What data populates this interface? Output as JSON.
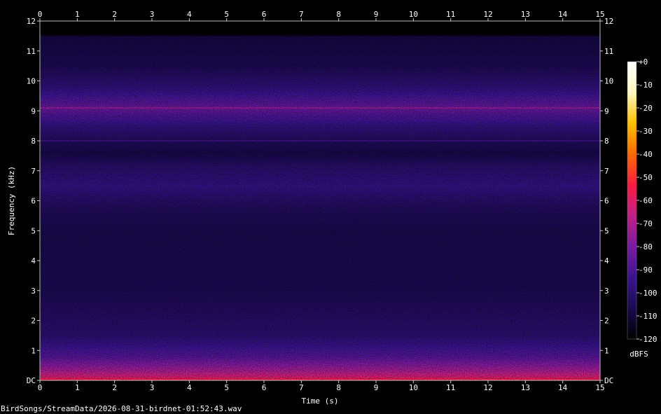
{
  "chart_data": {
    "type": "heatmap",
    "xlabel": "Time (s)",
    "ylabel": "Frequency (kHz)",
    "x_ticks": [
      "0",
      "1",
      "2",
      "3",
      "4",
      "5",
      "6",
      "7",
      "8",
      "9",
      "10",
      "11",
      "12",
      "13",
      "14",
      "15"
    ],
    "y_ticks": [
      "DC",
      "1",
      "2",
      "3",
      "4",
      "5",
      "6",
      "7",
      "8",
      "9",
      "10",
      "11",
      "12"
    ],
    "xlim": [
      0,
      15
    ],
    "ylim": [
      0,
      12
    ],
    "colorbar": {
      "label": "dBFS",
      "ticks": [
        "+0",
        "-10",
        "-20",
        "-30",
        "-40",
        "-50",
        "-60",
        "-70",
        "-80",
        "-90",
        "-100",
        "-110",
        "-120"
      ],
      "range": [
        -120,
        0
      ],
      "colormap": [
        "#000000",
        "#1a0a50",
        "#3b1490",
        "#7a1aa0",
        "#c0208a",
        "#ff1a40",
        "#ff6a00",
        "#ffc000",
        "#fff8c0",
        "#ffffff"
      ]
    },
    "intensity_profile": [
      {
        "freq_khz": 0.0,
        "db": -55
      },
      {
        "freq_khz": 0.3,
        "db": -70
      },
      {
        "freq_khz": 0.8,
        "db": -88
      },
      {
        "freq_khz": 1.5,
        "db": -100
      },
      {
        "freq_khz": 3.0,
        "db": -106
      },
      {
        "freq_khz": 5.0,
        "db": -107
      },
      {
        "freq_khz": 5.8,
        "db": -104
      },
      {
        "freq_khz": 6.5,
        "db": -96
      },
      {
        "freq_khz": 7.2,
        "db": -102
      },
      {
        "freq_khz": 7.6,
        "db": -108
      },
      {
        "freq_khz": 8.0,
        "db": -104
      },
      {
        "freq_khz": 8.5,
        "db": -97
      },
      {
        "freq_khz": 9.1,
        "db": -84
      },
      {
        "freq_khz": 9.8,
        "db": -98
      },
      {
        "freq_khz": 10.5,
        "db": -106
      },
      {
        "freq_khz": 11.5,
        "db": -109
      },
      {
        "freq_khz": 11.6,
        "db": -125
      },
      {
        "freq_khz": 12.0,
        "db": -125
      }
    ],
    "tonal_lines_khz": [
      8.0,
      9.1
    ]
  },
  "footer": {
    "filename": "BirdSongs/StreamData/2026-08-31-birdnet-01:52:43.wav"
  }
}
